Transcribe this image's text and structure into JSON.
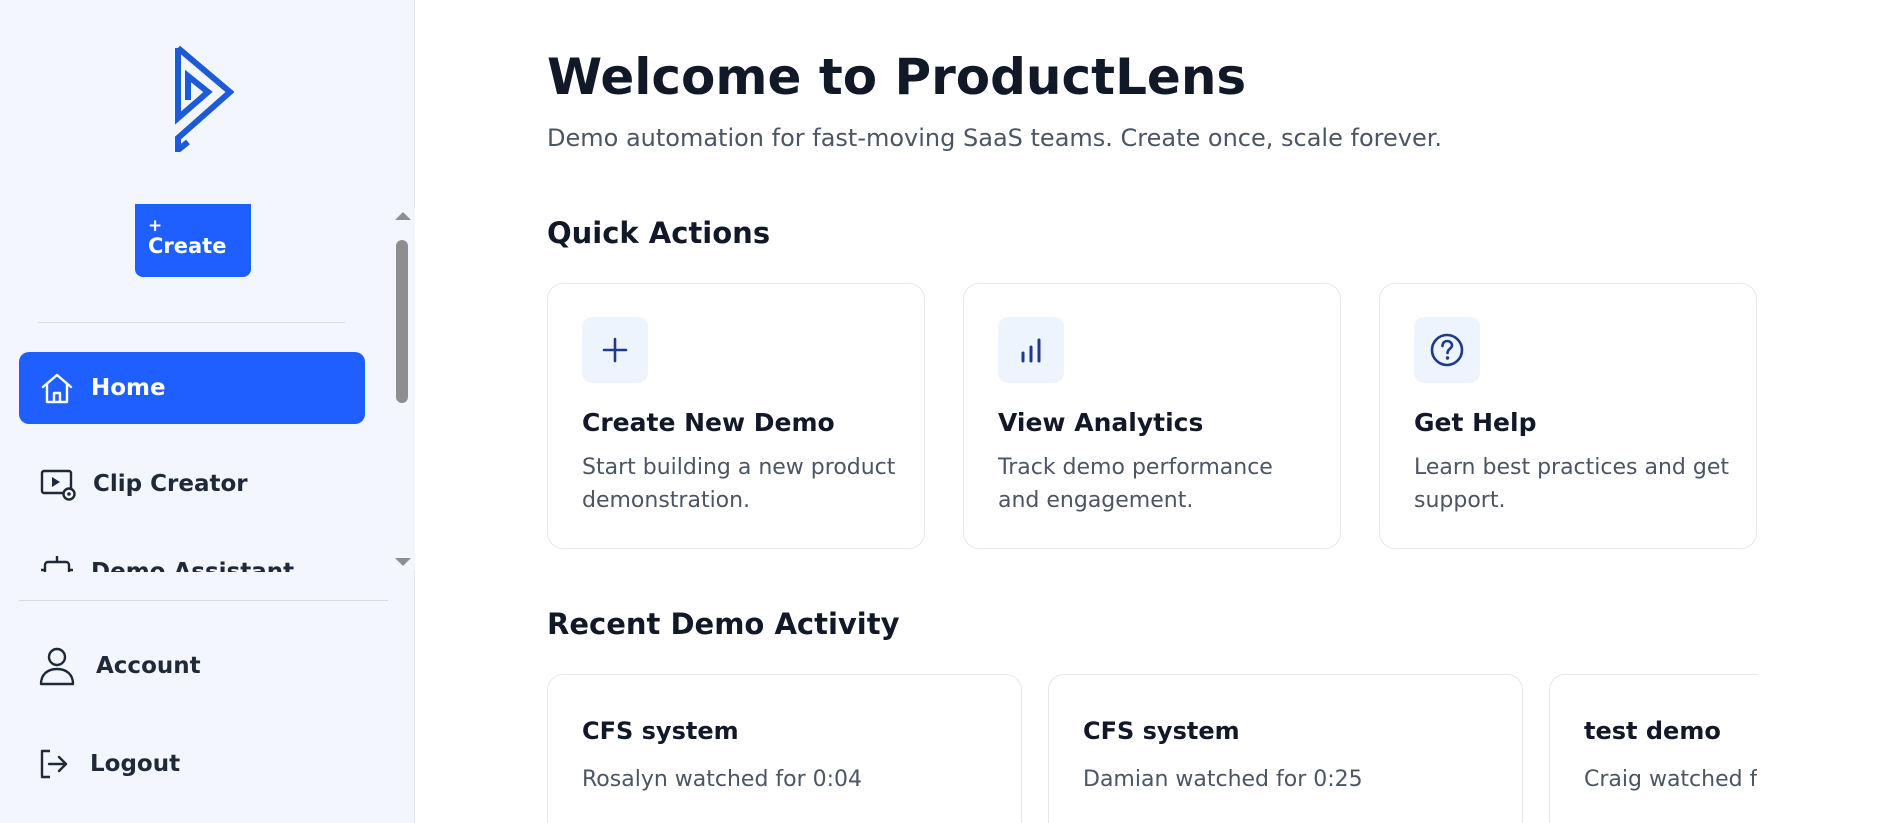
{
  "sidebar": {
    "create_plus": "+",
    "create_label": "Create",
    "nav_items": [
      {
        "label": "Home",
        "icon": "home-icon"
      },
      {
        "label": "Clip Creator",
        "icon": "video-settings-icon"
      },
      {
        "label": "Demo Assistant",
        "icon": "robot-icon"
      }
    ],
    "bottom_items": [
      {
        "label": "Account",
        "icon": "user-icon"
      },
      {
        "label": "Logout",
        "icon": "logout-icon"
      }
    ]
  },
  "main": {
    "title": "Welcome to ProductLens",
    "subtitle": "Demo automation for fast-moving SaaS teams. Create once, scale forever.",
    "quick_actions": {
      "heading": "Quick Actions",
      "cards": [
        {
          "title": "Create New Demo",
          "description": "Start building a new product demonstration.",
          "icon": "plus-icon"
        },
        {
          "title": "View Analytics",
          "description": "Track demo performance and engagement.",
          "icon": "bar-chart-icon"
        },
        {
          "title": "Get Help",
          "description": "Learn best practices and get support.",
          "icon": "help-circle-icon"
        }
      ]
    },
    "recent_activity": {
      "heading": "Recent Demo Activity",
      "items": [
        {
          "title": "CFS system",
          "description": "Rosalyn watched for 0:04"
        },
        {
          "title": "CFS system",
          "description": "Damian watched for 0:25"
        },
        {
          "title": "test demo",
          "description": "Craig watched for"
        }
      ]
    }
  },
  "colors": {
    "accent": "#1f5eff",
    "sidebar_bg": "#f3f7fd",
    "icon_navy": "#1e3a8a"
  }
}
